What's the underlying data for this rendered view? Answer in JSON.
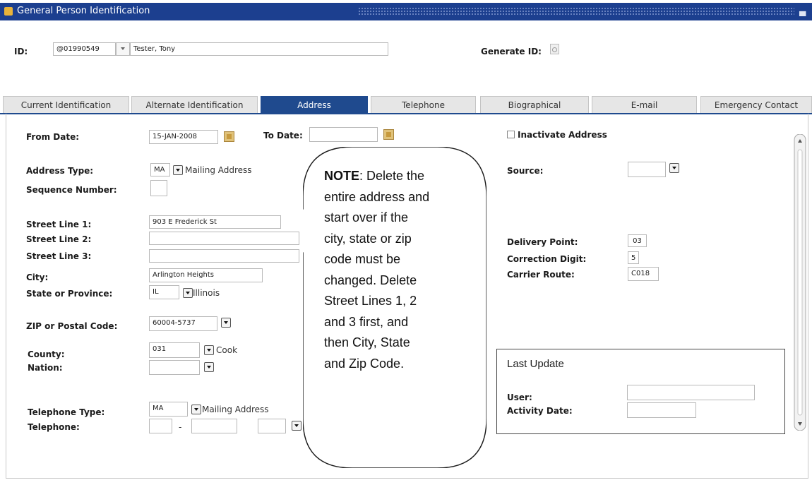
{
  "window": {
    "title": "General Person Identification"
  },
  "header": {
    "id_label": "ID:",
    "id_value": "@01990549",
    "name_value": "Tester, Tony",
    "generate_id_label": "Generate ID:"
  },
  "tabs": [
    {
      "label": "Current Identification"
    },
    {
      "label": "Alternate Identification"
    },
    {
      "label": "Address",
      "active": true
    },
    {
      "label": "Telephone"
    },
    {
      "label": "Biographical"
    },
    {
      "label": "E-mail"
    },
    {
      "label": "Emergency Contact"
    }
  ],
  "address": {
    "from_date_label": "From Date:",
    "from_date_value": "15-JAN-2008",
    "to_date_label": "To Date:",
    "to_date_value": "",
    "inactivate_label": "Inactivate Address",
    "address_type_label": "Address Type:",
    "address_type_code": "MA",
    "address_type_desc": "Mailing Address",
    "sequence_label": "Sequence Number:",
    "sequence_value": "",
    "street1_label": "Street Line 1:",
    "street1_value": "903 E Frederick St",
    "street2_label": "Street Line 2:",
    "street2_value": "",
    "street3_label": "Street Line 3:",
    "street3_value": "",
    "city_label": "City:",
    "city_value": "Arlington Heights",
    "state_label": "State or Province:",
    "state_code": "IL",
    "state_desc": "Illinois",
    "zip_label": "ZIP or Postal Code:",
    "zip_value": "60004-5737",
    "county_label": "County:",
    "county_code": "031",
    "county_desc": "Cook",
    "nation_label": "Nation:",
    "nation_value": "",
    "tel_type_label": "Telephone Type:",
    "tel_type_code": "MA",
    "tel_type_desc": "Mailing Address",
    "telephone_label": "Telephone:",
    "telephone_sep": "-",
    "source_label": "Source:",
    "source_value": "",
    "delivery_label": "Delivery Point:",
    "delivery_value": "03",
    "correction_label": "Correction Digit:",
    "correction_value": "5",
    "carrier_label": "Carrier Route:",
    "carrier_value": "C018"
  },
  "last_update": {
    "title": "Last Update",
    "user_label": "User:",
    "user_value": "",
    "activity_label": "Activity Date:",
    "activity_value": ""
  },
  "note": {
    "bold": "NOTE",
    "line1_rest": ": Delete the",
    "line2": "entire address and",
    "line3": "start over if the",
    "line4": "city, state or zip",
    "line5": "code must be",
    "line6": "changed. Delete",
    "line7": "Street Lines 1, 2",
    "line8": "and 3 first, and",
    "line9": "then City, State",
    "line10": "and Zip Code."
  },
  "colors": {
    "title_bar": "#1c3f8f",
    "active_tab": "#1f4a8e"
  },
  "icons": [
    "app-icon",
    "minimize-icon",
    "calendar-icon",
    "dropdown-arrow-icon",
    "generate-id-icon",
    "scroll-up-icon",
    "scroll-down-icon"
  ]
}
